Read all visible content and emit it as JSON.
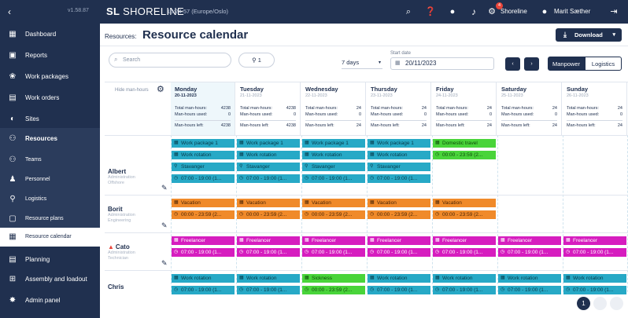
{
  "topbar": {
    "version": "v1.58.87",
    "logo": "SHORELINE",
    "time": "15:24:57",
    "timezone": "(Europe/Oslo)",
    "notif_count": "4",
    "project": "Shoreline",
    "user": "Marit Sæther"
  },
  "sidebar": {
    "items": [
      {
        "label": "Dashboard",
        "icon": "dashboard-icon"
      },
      {
        "label": "Reports",
        "icon": "reports-icon"
      },
      {
        "label": "Work packages",
        "icon": "work-packages-icon"
      },
      {
        "label": "Work orders",
        "icon": "work-orders-icon"
      },
      {
        "label": "Sites",
        "icon": "sites-icon"
      },
      {
        "label": "Resources",
        "icon": "resources-icon"
      },
      {
        "label": "Teams",
        "icon": "teams-icon"
      },
      {
        "label": "Personnel",
        "icon": "personnel-icon"
      },
      {
        "label": "Logistics",
        "icon": "logistics-icon"
      },
      {
        "label": "Resource plans",
        "icon": "resource-plans-icon"
      },
      {
        "label": "Resource calendar",
        "icon": "calendar-icon"
      },
      {
        "label": "Planning",
        "icon": "planning-icon"
      },
      {
        "label": "Assembly and loadout",
        "icon": "assembly-icon"
      },
      {
        "label": "Admin panel",
        "icon": "admin-icon"
      }
    ]
  },
  "header": {
    "breadcrumb": "Resources",
    "title": "Resource calendar",
    "download": "Download"
  },
  "filters": {
    "search_placeholder": "Search",
    "filter_chip": "1",
    "days": "7 days",
    "start_date_label": "Start date",
    "start_date": "20/11/2023",
    "segments": [
      "Manpower",
      "Logistics"
    ]
  },
  "calendar": {
    "hide_label": "Hide man-hours",
    "days": [
      {
        "name": "Monday",
        "date": "20-11-2023",
        "total": "4238",
        "used": "0",
        "left": "4238"
      },
      {
        "name": "Tuesday",
        "date": "21-11-2023",
        "total": "4238",
        "used": "0",
        "left": "4238"
      },
      {
        "name": "Wednesday",
        "date": "22-11-2023",
        "total": "24",
        "used": "0",
        "left": "24"
      },
      {
        "name": "Thursday",
        "date": "23-11-2023",
        "total": "24",
        "used": "0",
        "left": "24"
      },
      {
        "name": "Friday",
        "date": "24-11-2023",
        "total": "24",
        "used": "0",
        "left": "24"
      },
      {
        "name": "Saturday",
        "date": "25-11-2023",
        "total": "24",
        "used": "0",
        "left": "24"
      },
      {
        "name": "Sunday",
        "date": "26-11-2023",
        "total": "24",
        "used": "0",
        "left": "24"
      }
    ],
    "labels": {
      "total": "Total man-hours:",
      "used": "Man-hours used:",
      "left": "Man-hours left:"
    },
    "people": [
      {
        "name": "Albert",
        "sub1": "Administration",
        "sub2": "Offshore",
        "warn": false
      },
      {
        "name": "Borit",
        "sub1": "Administration",
        "sub2": "Engineering",
        "warn": false
      },
      {
        "name": "Cato",
        "sub1": "Administration",
        "sub2": "Technician",
        "warn": true
      },
      {
        "name": "Chris",
        "sub1": "",
        "sub2": "",
        "warn": false
      }
    ],
    "events": {
      "wp1": "Work package 1",
      "rotation": "Work rotation",
      "stavanger": "Stavanger",
      "time_0700": "07:00 - 19:00 (1...",
      "domestic": "Domestic travel",
      "time_0000_fri": "00:00 - 23:59 (2...",
      "vacation": "Vacation",
      "time_0000": "00:00 - 23:59 (2...",
      "freelancer": "Freelancer",
      "sickness": "Sickness",
      "time_sick": "00:00 - 23:59 (2..."
    },
    "page": "1"
  }
}
